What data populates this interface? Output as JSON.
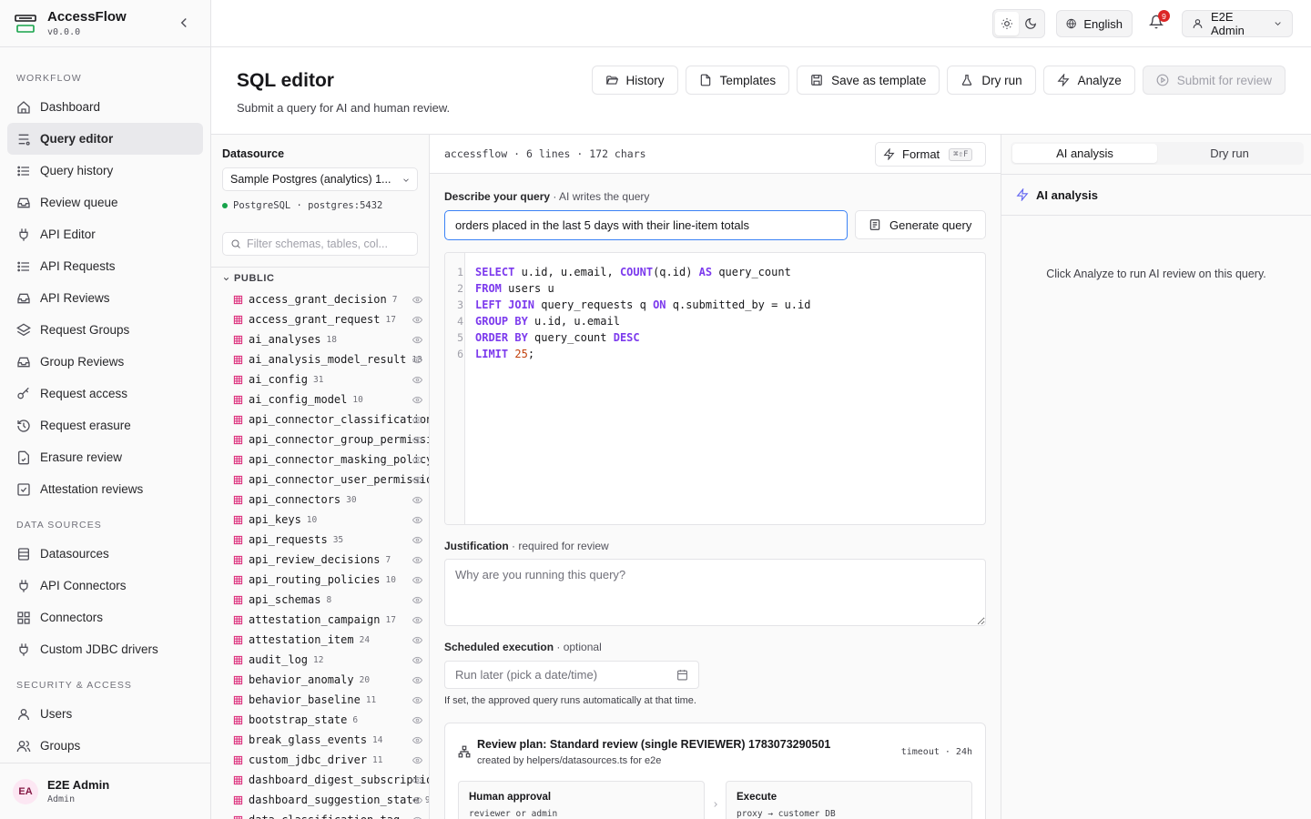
{
  "app": {
    "name": "AccessFlow",
    "version": "v0.0.0"
  },
  "sidebar": {
    "sections": [
      {
        "title": "WORKFLOW",
        "items": [
          {
            "label": "Dashboard",
            "icon": "home-icon"
          },
          {
            "label": "Query editor",
            "icon": "code-icon",
            "active": true
          },
          {
            "label": "Query history",
            "icon": "list-icon"
          },
          {
            "label": "Review queue",
            "icon": "inbox-icon"
          },
          {
            "label": "API Editor",
            "icon": "plug-icon"
          },
          {
            "label": "API Requests",
            "icon": "list-icon"
          },
          {
            "label": "API Reviews",
            "icon": "inbox-icon"
          },
          {
            "label": "Request Groups",
            "icon": "layers-icon"
          },
          {
            "label": "Group Reviews",
            "icon": "inbox-icon"
          },
          {
            "label": "Request access",
            "icon": "key-icon"
          },
          {
            "label": "Request erasure",
            "icon": "history-icon"
          },
          {
            "label": "Erasure review",
            "icon": "file-check-icon"
          },
          {
            "label": "Attestation reviews",
            "icon": "checkbox-icon"
          }
        ]
      },
      {
        "title": "DATA SOURCES",
        "items": [
          {
            "label": "Datasources",
            "icon": "database-icon"
          },
          {
            "label": "API Connectors",
            "icon": "plug-icon"
          },
          {
            "label": "Connectors",
            "icon": "grid-icon"
          },
          {
            "label": "Custom JDBC drivers",
            "icon": "plug-icon"
          }
        ]
      },
      {
        "title": "SECURITY & ACCESS",
        "items": [
          {
            "label": "Users",
            "icon": "user-icon"
          },
          {
            "label": "Groups",
            "icon": "users-icon"
          }
        ]
      }
    ],
    "user": {
      "initials": "EA",
      "name": "E2E Admin",
      "role": "Admin"
    }
  },
  "topbar": {
    "language": "English",
    "notifications": "9",
    "user": "E2E Admin"
  },
  "header": {
    "title": "SQL editor",
    "subtitle": "Submit a query for AI and human review.",
    "buttons": {
      "history": "History",
      "templates": "Templates",
      "save_template": "Save as template",
      "dry_run": "Dry run",
      "analyze": "Analyze",
      "submit": "Submit for review"
    }
  },
  "schema": {
    "datasource_label": "Datasource",
    "datasource_value": "Sample Postgres (analytics) 1...",
    "status": "PostgreSQL · postgres:5432",
    "search_placeholder": "Filter schemas, tables, col...",
    "group": "PUBLIC",
    "tables": [
      {
        "name": "access_grant_decision",
        "count": "7"
      },
      {
        "name": "access_grant_request",
        "count": "17"
      },
      {
        "name": "ai_analyses",
        "count": "18"
      },
      {
        "name": "ai_analysis_model_result",
        "count": "13"
      },
      {
        "name": "ai_config",
        "count": "31"
      },
      {
        "name": "ai_config_model",
        "count": "10"
      },
      {
        "name": "api_connector_classification",
        "count": ""
      },
      {
        "name": "api_connector_group_permissi",
        "count": ""
      },
      {
        "name": "api_connector_masking_policy",
        "count": ""
      },
      {
        "name": "api_connector_user_permissio",
        "count": ""
      },
      {
        "name": "api_connectors",
        "count": "30"
      },
      {
        "name": "api_keys",
        "count": "10"
      },
      {
        "name": "api_requests",
        "count": "35"
      },
      {
        "name": "api_review_decisions",
        "count": "7"
      },
      {
        "name": "api_routing_policies",
        "count": "10"
      },
      {
        "name": "api_schemas",
        "count": "8"
      },
      {
        "name": "attestation_campaign",
        "count": "17"
      },
      {
        "name": "attestation_item",
        "count": "24"
      },
      {
        "name": "audit_log",
        "count": "12"
      },
      {
        "name": "behavior_anomaly",
        "count": "20"
      },
      {
        "name": "behavior_baseline",
        "count": "11"
      },
      {
        "name": "bootstrap_state",
        "count": "6"
      },
      {
        "name": "break_glass_events",
        "count": "14"
      },
      {
        "name": "custom_jdbc_driver",
        "count": "11"
      },
      {
        "name": "dashboard_digest_subscriptio",
        "count": ""
      },
      {
        "name": "dashboard_suggestion_state",
        "count": "9"
      },
      {
        "name": "data_classification_tag",
        "count": ""
      }
    ]
  },
  "editor": {
    "meta": "accessflow · 6 lines · 172 chars",
    "format_label": "Format",
    "format_shortcut": "⌘⇧F",
    "describe_label": "Describe your query",
    "describe_hint": " · AI writes the query",
    "describe_value": "orders placed in the last 5 days with their line-item totals",
    "generate_label": "Generate query",
    "code": [
      [
        [
          "kw",
          "SELECT"
        ],
        [
          "t",
          " u.id, u.email, "
        ],
        [
          "kw",
          "COUNT"
        ],
        [
          "t",
          "(q.id) "
        ],
        [
          "kw",
          "AS"
        ],
        [
          "t",
          " query_count"
        ]
      ],
      [
        [
          "kw",
          "FROM"
        ],
        [
          "t",
          " users u"
        ]
      ],
      [
        [
          "kw",
          "LEFT JOIN"
        ],
        [
          "t",
          " query_requests q "
        ],
        [
          "kw",
          "ON"
        ],
        [
          "t",
          " q.submitted_by = u.id"
        ]
      ],
      [
        [
          "kw",
          "GROUP BY"
        ],
        [
          "t",
          " u.id, u.email"
        ]
      ],
      [
        [
          "kw",
          "ORDER BY"
        ],
        [
          "t",
          " query_count "
        ],
        [
          "kw",
          "DESC"
        ]
      ],
      [
        [
          "kw",
          "LIMIT"
        ],
        [
          "t",
          " "
        ],
        [
          "nm",
          "25"
        ],
        [
          "t",
          ";"
        ]
      ]
    ],
    "justification_label": "Justification",
    "justification_hint": " · required for review",
    "justification_placeholder": "Why are you running this query?",
    "schedule_label": "Scheduled execution",
    "schedule_hint": " · optional",
    "schedule_placeholder": "Run later (pick a date/time)",
    "schedule_help": "If set, the approved query runs automatically at that time.",
    "plan": {
      "title": "Review plan: Standard review (single REVIEWER) 1783073290501",
      "subtitle": "created by helpers/datasources.ts for e2e",
      "timeout": "timeout · 24h",
      "stages": [
        {
          "title": "Human approval",
          "detail": "reviewer or admin"
        },
        {
          "title": "Execute",
          "detail": "proxy → customer DB"
        }
      ]
    }
  },
  "right": {
    "tabs": [
      "AI analysis",
      "Dry run"
    ],
    "heading": "AI analysis",
    "empty": "Click Analyze to run AI review on this query."
  }
}
